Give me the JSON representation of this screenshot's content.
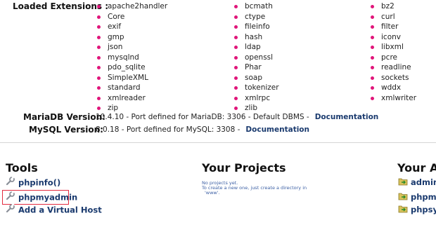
{
  "extensions": {
    "label": "Loaded Extensions :",
    "columns": [
      [
        "apache2handler",
        "Core",
        "exif",
        "gmp",
        "json",
        "mysqlnd",
        "pdo_sqlite",
        "SimpleXML",
        "standard",
        "xmlreader",
        "zip"
      ],
      [
        "bcmath",
        "ctype",
        "fileinfo",
        "hash",
        "ldap",
        "openssl",
        "Phar",
        "soap",
        "tokenizer",
        "xmlrpc",
        "zlib"
      ],
      [
        "bz2",
        "curl",
        "filter",
        "iconv",
        "libxml",
        "pcre",
        "readline",
        "sockets",
        "wddx",
        "xmlwriter"
      ]
    ],
    "bullet_color": "#e0157a"
  },
  "mariadb": {
    "label": "MariaDB Version:",
    "value": "10.4.10 - Port defined for MariaDB: 3306 - Default DBMS -",
    "link": "Documentation"
  },
  "mysql": {
    "label": "MySQL Version:",
    "value": "8.0.18 - Port defined for MySQL: 3308 -",
    "link": "Documentation"
  },
  "tools": {
    "title": "Tools",
    "items": [
      "phpinfo()",
      "phpmyadmin",
      "Add a Virtual Host"
    ]
  },
  "projects": {
    "title": "Your Projects",
    "empty_line1": "No projects yet.",
    "empty_line2": "To create a new one, just create a directory in",
    "empty_line3": "'www'."
  },
  "aliases": {
    "title": "Your Al",
    "items": [
      "admine",
      "phpmy",
      "phpsys"
    ]
  },
  "colors": {
    "link": "#1a3a6e",
    "highlight_border": "#e32b3f"
  }
}
